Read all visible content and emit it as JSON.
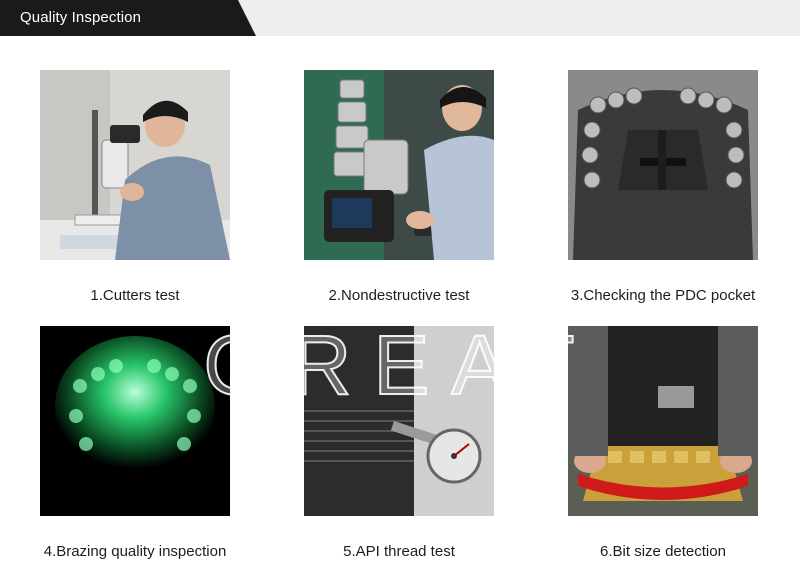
{
  "header": {
    "title": "Quality Inspection"
  },
  "items": [
    {
      "caption": "1.Cutters test"
    },
    {
      "caption": "2.Nondestructive test"
    },
    {
      "caption": "3.Checking the PDC pocket"
    },
    {
      "caption": "4.Brazing quality inspection"
    },
    {
      "caption": "5.API thread test"
    },
    {
      "caption": "6.Bit size detection"
    }
  ],
  "watermark": {
    "text": "GREAT"
  }
}
